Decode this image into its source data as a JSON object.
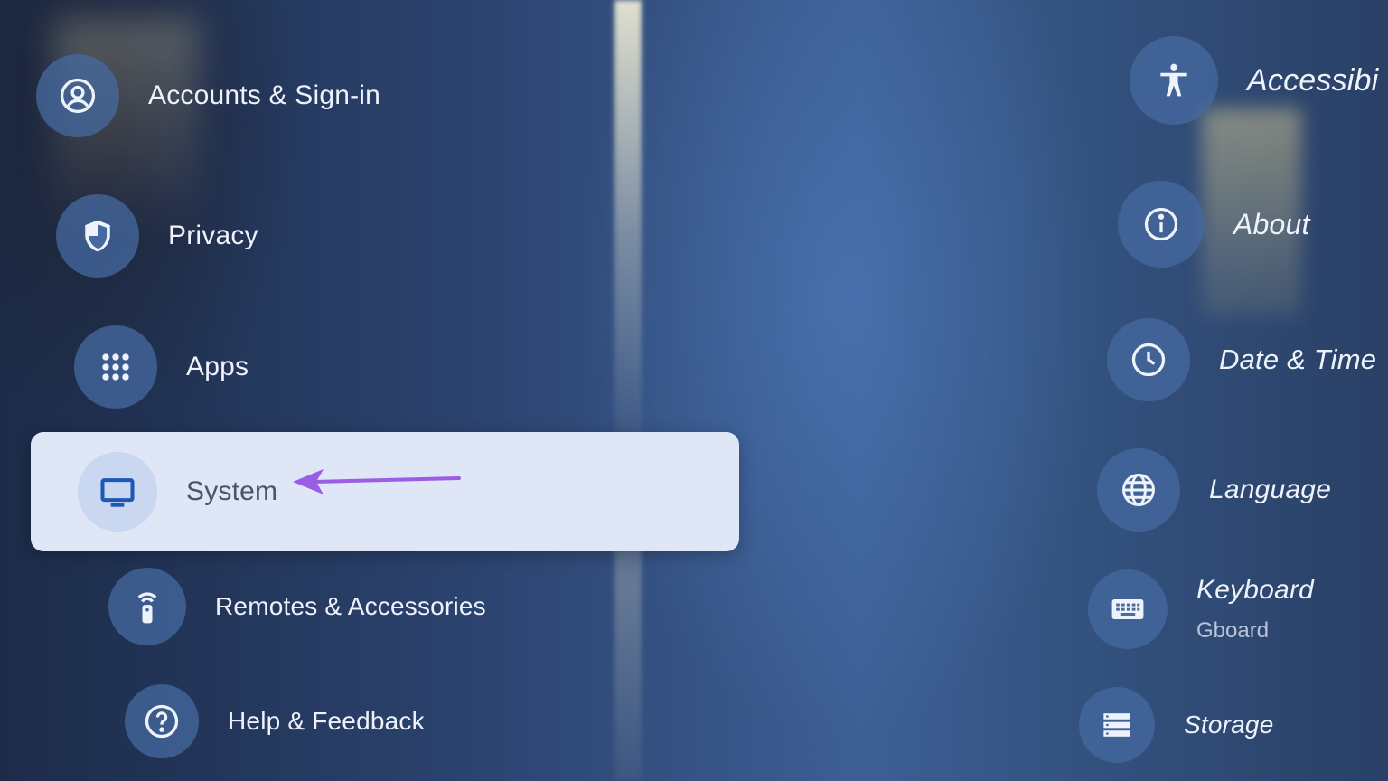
{
  "left_menu": {
    "accounts": {
      "label": "Accounts & Sign-in",
      "icon": "account-circle-icon"
    },
    "privacy": {
      "label": "Privacy",
      "icon": "shield-icon"
    },
    "apps": {
      "label": "Apps",
      "icon": "apps-grid-icon"
    },
    "system": {
      "label": "System",
      "icon": "tv-icon"
    },
    "remotes": {
      "label": "Remotes & Accessories",
      "icon": "remote-icon"
    },
    "help": {
      "label": "Help & Feedback",
      "icon": "help-icon"
    }
  },
  "right_menu": {
    "accessibility": {
      "label": "Accessibi",
      "icon": "accessibility-icon"
    },
    "about": {
      "label": "About",
      "icon": "info-icon"
    },
    "datetime": {
      "label": "Date & Time",
      "icon": "clock-icon"
    },
    "language": {
      "label": "Language",
      "icon": "globe-icon"
    },
    "keyboard": {
      "label": "Keyboard",
      "sublabel": "Gboard",
      "icon": "keyboard-icon"
    },
    "storage": {
      "label": "Storage",
      "icon": "storage-icon"
    }
  },
  "annotation": {
    "arrow_color": "#9b5de5"
  },
  "colors": {
    "selected_bg": "#dfe6f5",
    "icon_circle": "#46699f"
  }
}
